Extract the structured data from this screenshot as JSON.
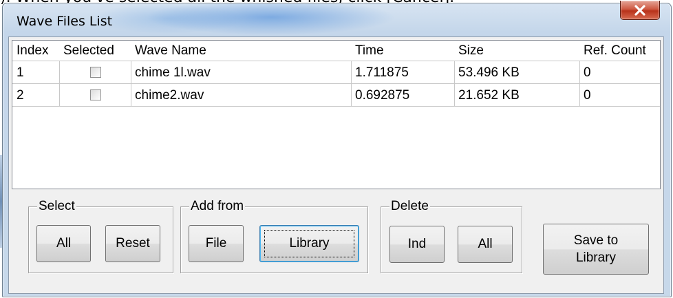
{
  "doc_caption": "). When you've selected all the whished files, click [Cancel].",
  "window": {
    "title": "Wave Files List",
    "close_glyph": "✕"
  },
  "list": {
    "columns": [
      "Index",
      "Selected",
      "Wave Name",
      "Time",
      "Size",
      "Ref. Count"
    ],
    "rows": [
      {
        "index": "1",
        "selected": false,
        "name": "chime 1l.wav",
        "time": "1.711875",
        "size": "53.496 KB",
        "ref_count": "0"
      },
      {
        "index": "2",
        "selected": false,
        "name": "chime2.wav",
        "time": "0.692875",
        "size": "21.652 KB",
        "ref_count": "0"
      }
    ]
  },
  "groups": {
    "select": {
      "label": "Select",
      "all": "All",
      "reset": "Reset"
    },
    "add_from": {
      "label": "Add from",
      "file": "File",
      "library": "Library"
    },
    "delete": {
      "label": "Delete",
      "ind": "Ind",
      "all": "All"
    }
  },
  "save_to_library": {
    "line1": "Save to",
    "line2": "Library"
  },
  "colors": {
    "close_button": "#c8452c",
    "list_background": "#ffffff",
    "client_background": "#f0f0f0"
  }
}
